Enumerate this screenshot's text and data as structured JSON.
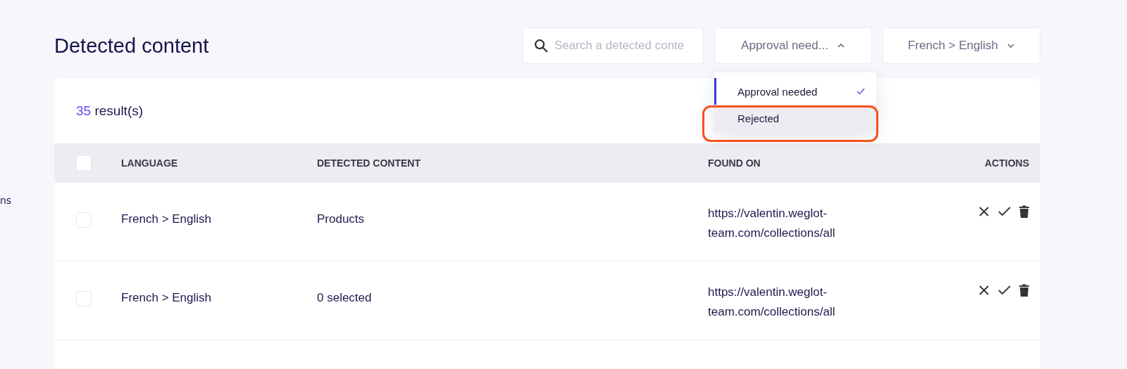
{
  "sidebar_fragment": "ns",
  "page_title": "Detected content",
  "search": {
    "placeholder": "Search a detected conte"
  },
  "status_filter": {
    "label": "Approval need...",
    "expanded": true,
    "options": [
      {
        "label": "Approval needed",
        "selected": true,
        "highlighted": false
      },
      {
        "label": "Rejected",
        "selected": false,
        "highlighted": true
      }
    ]
  },
  "language_filter": {
    "label": "French > English",
    "expanded": false
  },
  "results": {
    "count": "35",
    "label": "result(s)"
  },
  "table": {
    "columns": [
      "LANGUAGE",
      "DETECTED CONTENT",
      "FOUND ON",
      "ACTIONS"
    ],
    "header_checked": false,
    "rows": [
      {
        "checked": false,
        "language": "French > English",
        "content": "Products",
        "found_on": "https://valentin.weglot-team.com/collections/all"
      },
      {
        "checked": false,
        "language": "French > English",
        "content": "0 selected",
        "found_on": "https://valentin.weglot-team.com/collections/all"
      }
    ]
  }
}
